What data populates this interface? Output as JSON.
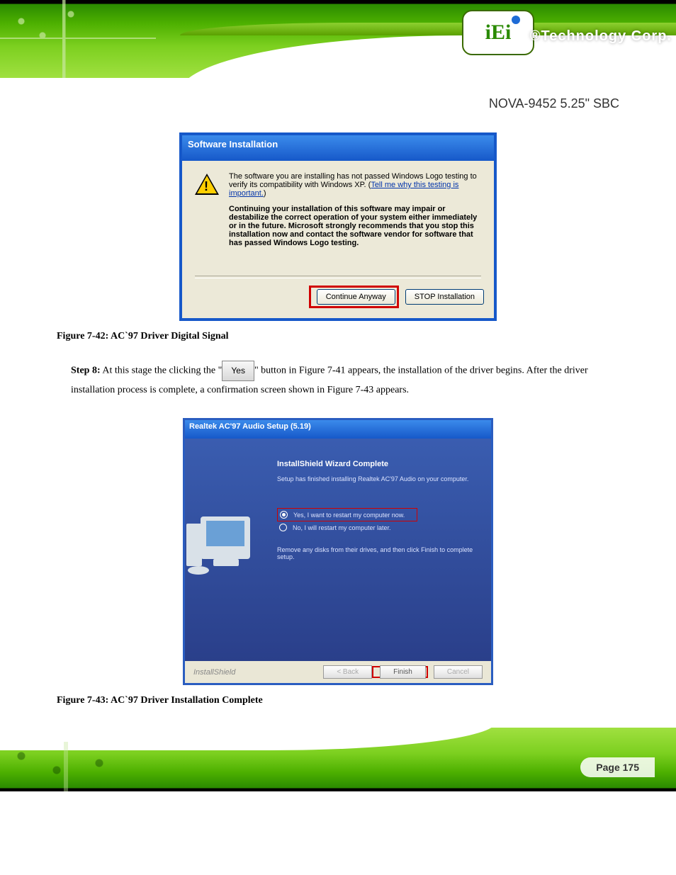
{
  "brand": {
    "logo": "iEi",
    "tagline": "®Technology Corp."
  },
  "heading": "NOVA-9452 5.25\" SBC",
  "dialog1": {
    "title": "Software Installation",
    "line1": "The software you are installing has not passed Windows Logo testing to verify its compatibility with Windows XP. (",
    "link": "Tell me why this testing is important.",
    "line1b": ")",
    "bold": "Continuing your installation of this software may impair or destabilize the correct operation of your system either immediately or in the future. Microsoft strongly recommends that you stop this installation now and contact the software vendor for software that has passed Windows Logo testing.",
    "continue": "Continue Anyway",
    "stop": "STOP Installation"
  },
  "caption1": "Figure 7-42: AC`97 Driver Digital Signal",
  "step_prefix": "Step 8:",
  "step_text1": "At this stage the clicking the \"Yes\" button in Figure 7-41 appears, the installation of the driver begins. After the driver installation process is complete, a confirmation screen shown in Figure 7-43 appears.",
  "step_yes": "Yes",
  "dialog2": {
    "title": "Realtek AC'97 Audio Setup (5.19)",
    "heading": "InstallShield Wizard Complete",
    "sub": "Setup has finished installing Realtek AC'97 Audio on your computer.",
    "opt1": "Yes, I want to restart my computer now.",
    "opt2": "No, I will restart my computer later.",
    "remove": "Remove any disks from their drives, and then click Finish to complete setup.",
    "install_shield": "InstallShield",
    "back": "< Back",
    "finish": "Finish",
    "cancel": "Cancel"
  },
  "caption2": "Figure 7-43: AC`97 Driver Installation Complete",
  "page_number": "Page 175"
}
